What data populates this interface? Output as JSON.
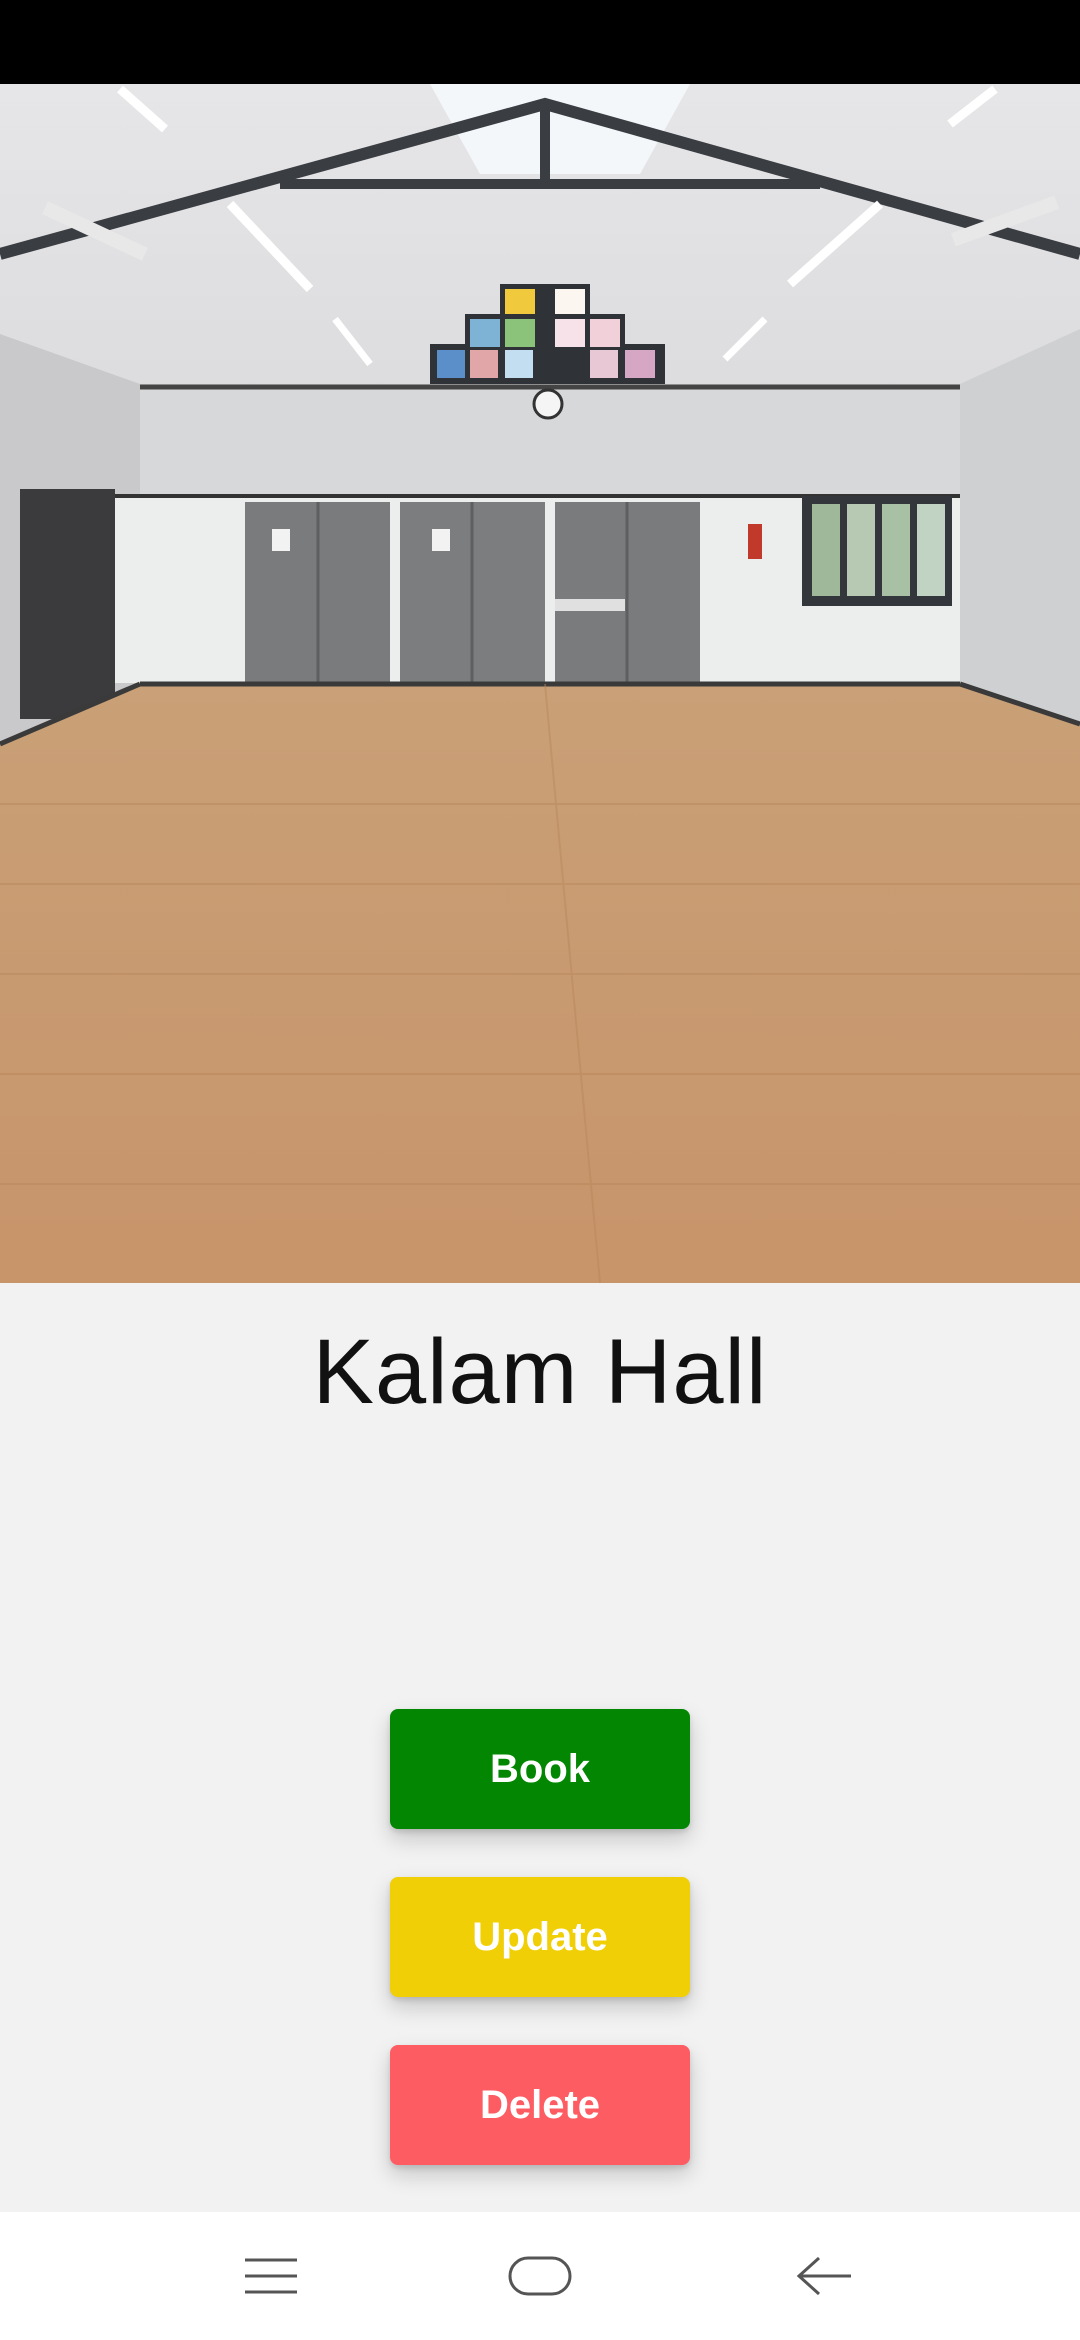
{
  "hall": {
    "name": "Kalam Hall",
    "photo_icon": "hall-interior-photo"
  },
  "actions": {
    "book_label": "Book",
    "update_label": "Update",
    "delete_label": "Delete"
  },
  "colors": {
    "book": "#038703",
    "update": "#f1cf07",
    "delete": "#fe5c63",
    "background": "#f2f2f2"
  },
  "navigation": {
    "menu_icon": "menu-icon",
    "home_icon": "home-icon",
    "back_icon": "back-icon"
  }
}
